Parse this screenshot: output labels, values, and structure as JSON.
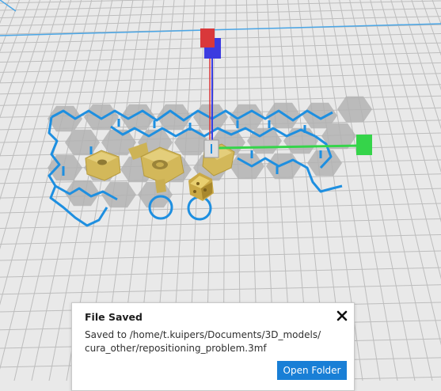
{
  "notification": {
    "title": "File Saved",
    "message": "Saved to /home/t.kuipers/Documents/3D_models/cura_other/repositioning_problem.3mf",
    "action_label": "Open Folder"
  },
  "viewport": {
    "icons": {
      "close": "close-icon",
      "move_handle_y": "move-y-handle-icon",
      "move_handle_z": "move-z-handle-icon",
      "move_handle_x": "move-x-handle-icon"
    },
    "colors": {
      "build_plate": "#e9e9e9",
      "grid_line": "#b8b8b8",
      "support_outline": "#1e8fe0",
      "model_gold": "#d7bd63",
      "shadow": "#b3b3b3",
      "axis_red": "#d9383a",
      "axis_blue": "#3b3be0",
      "axis_green": "#35d44a",
      "accent_button": "#197fd6"
    }
  }
}
